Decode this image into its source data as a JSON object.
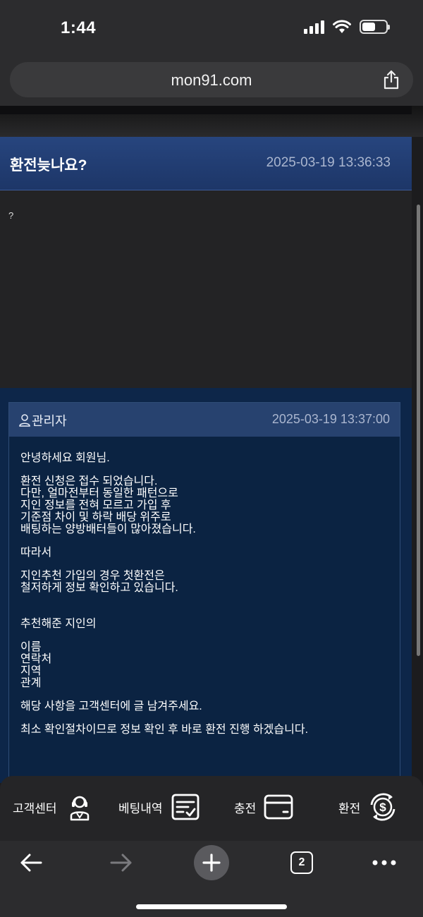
{
  "status": {
    "time": "1:44",
    "battery_level": 0.55
  },
  "browser": {
    "url": "mon91.com",
    "tab_count": "2"
  },
  "post": {
    "title": "환전늦나요?",
    "date": "2025-03-19 13:36:33",
    "content": "?"
  },
  "reply": {
    "author": "관리자",
    "date": "2025-03-19 13:37:00",
    "paragraphs": [
      "안녕하세요 회원님.",
      "환전 신청은 접수 되었습니다.\n다만, 얼마전부터 동일한 패턴으로\n지인 정보를 전혀 모르고 가입 후\n기준점 차이 및 하락 배당 위주로\n배팅하는 양방배터들이 많아졌습니다.",
      "따라서",
      "지인추천 가입의 경우 첫환전은\n철저하게 정보 확인하고 있습니다.",
      "추천해준 지인의",
      "이름\n연락처\n지역\n관계",
      "해당 사항을 고객센터에 글 남겨주세요.",
      "최소 확인절차이므로 정보 확인 후 바로 환전 진행 하겠습니다."
    ]
  },
  "bottom_menu": {
    "support_label": "고객센터",
    "betting_label": "베팅내역",
    "charge_label": "충전",
    "exchange_label": "환전"
  },
  "icons": {
    "share": "share-icon",
    "back": "back-arrow-icon",
    "forward": "forward-arrow-icon",
    "new_tab": "plus-icon",
    "tabs": "tabs-icon",
    "more": "more-icon",
    "user": "user-icon",
    "headset": "headset-icon",
    "list_check": "list-check-icon",
    "card": "card-icon",
    "exchange": "dollar-exchange-icon"
  },
  "colors": {
    "header_blue": "#27457e",
    "reply_bg": "#0b2342",
    "reply_head": "#27426f",
    "date_gray": "#aab6cf"
  }
}
